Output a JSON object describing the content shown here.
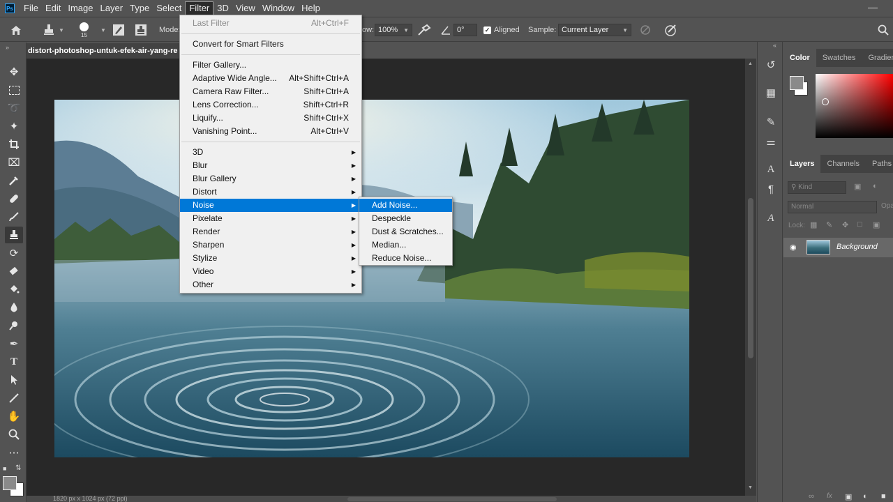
{
  "app": {
    "logo": "Ps"
  },
  "menubar": [
    "File",
    "Edit",
    "Image",
    "Layer",
    "Type",
    "Select",
    "Filter",
    "3D",
    "View",
    "Window",
    "Help"
  ],
  "active_menu": "Filter",
  "options": {
    "brush_size": "15",
    "mode_label": "Mode:",
    "flow_label": "ow:",
    "flow_value": "100%",
    "angle_value": "0°",
    "aligned_label": "Aligned",
    "aligned_checked": true,
    "sample_label": "Sample:",
    "sample_value": "Current Layer"
  },
  "document": {
    "tab_title": "distort-photoshop-untuk-efek-air-yang-re",
    "status": "1820 px x 1024 px (72 ppi)"
  },
  "filter_menu": {
    "items": [
      {
        "label": "Last Filter",
        "shortcut": "Alt+Ctrl+F",
        "disabled": true
      },
      {
        "label": "Convert for Smart Filters",
        "shortcut": ""
      },
      {
        "label": "Filter Gallery...",
        "shortcut": ""
      },
      {
        "label": "Adaptive Wide Angle...",
        "shortcut": "Alt+Shift+Ctrl+A"
      },
      {
        "label": "Camera Raw Filter...",
        "shortcut": "Shift+Ctrl+A"
      },
      {
        "label": "Lens Correction...",
        "shortcut": "Shift+Ctrl+R"
      },
      {
        "label": "Liquify...",
        "shortcut": "Shift+Ctrl+X"
      },
      {
        "label": "Vanishing Point...",
        "shortcut": "Alt+Ctrl+V"
      },
      {
        "label": "3D",
        "submenu": true
      },
      {
        "label": "Blur",
        "submenu": true
      },
      {
        "label": "Blur Gallery",
        "submenu": true
      },
      {
        "label": "Distort",
        "submenu": true
      },
      {
        "label": "Noise",
        "submenu": true,
        "highlighted": true
      },
      {
        "label": "Pixelate",
        "submenu": true
      },
      {
        "label": "Render",
        "submenu": true
      },
      {
        "label": "Sharpen",
        "submenu": true
      },
      {
        "label": "Stylize",
        "submenu": true
      },
      {
        "label": "Video",
        "submenu": true
      },
      {
        "label": "Other",
        "submenu": true
      }
    ]
  },
  "noise_submenu": {
    "items": [
      {
        "label": "Add Noise...",
        "highlighted": true
      },
      {
        "label": "Despeckle"
      },
      {
        "label": "Dust & Scratches..."
      },
      {
        "label": "Median..."
      },
      {
        "label": "Reduce Noise..."
      }
    ]
  },
  "color_panel": {
    "tabs": [
      "Color",
      "Swatches",
      "Gradients"
    ],
    "active_tab": "Color",
    "foreground": "#8a8a8a",
    "background": "#ffffff",
    "hue": "#ff0000"
  },
  "layers_panel": {
    "tabs": [
      "Layers",
      "Channels",
      "Paths"
    ],
    "active_tab": "Layers",
    "filter_placeholder": "Kind",
    "blend_mode": "Normal",
    "opacity_label": "Opa",
    "lock_label": "Lock:",
    "layers": [
      {
        "name": "Background",
        "visible": true
      }
    ]
  },
  "icons": {
    "home": "home-icon",
    "stamp": "clone-stamp-icon",
    "brush_preset": "brush-preset-icon",
    "toggle_brush": "brush-settings-icon",
    "clone_source": "clone-source-icon",
    "airbrush": "airbrush-icon",
    "angle": "angle-icon",
    "ignore_adjustment": "ignore-adjustment-icon",
    "pressure": "pressure-icon",
    "search": "search-icon"
  }
}
